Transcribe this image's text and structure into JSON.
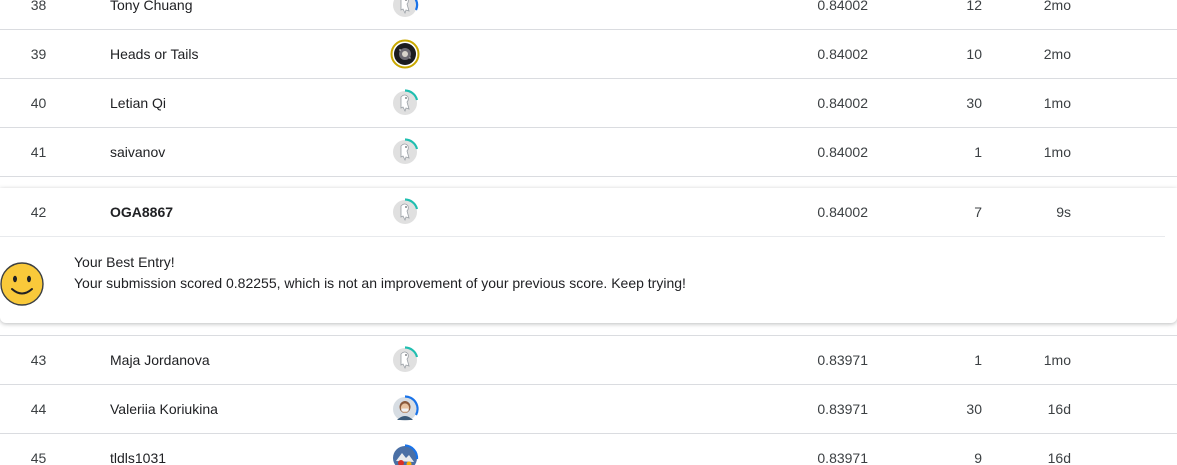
{
  "rows_above": [
    {
      "rank": "38",
      "name": "Tony Chuang",
      "score": "0.84002",
      "entries": "12",
      "last": "2mo",
      "avatar": "default-penguin",
      "ring_color": "#1a73e8"
    },
    {
      "rank": "39",
      "name": "Heads or Tails",
      "score": "0.84002",
      "entries": "10",
      "last": "2mo",
      "avatar": "galaxy-photo",
      "ring_color": "#c9a800"
    },
    {
      "rank": "40",
      "name": "Letian Qi",
      "score": "0.84002",
      "entries": "30",
      "last": "1mo",
      "avatar": "default-penguin",
      "ring_color": "#20beb0"
    },
    {
      "rank": "41",
      "name": "saivanov",
      "score": "0.84002",
      "entries": "1",
      "last": "1mo",
      "avatar": "default-penguin",
      "ring_color": "#20beb0"
    }
  ],
  "own_entry": {
    "rank": "42",
    "name": "OGA8867",
    "score": "0.84002",
    "entries": "7",
    "last": "9s",
    "avatar": "default-penguin",
    "ring_color": "#20beb0",
    "best_title": "Your Best Entry!",
    "best_message": "Your submission scored 0.82255, which is not an improvement of your previous score. Keep trying!",
    "smiley_icon": "smiley-face-icon",
    "smiley_color": "#f9c93a"
  },
  "rows_below": [
    {
      "rank": "43",
      "name": "Maja Jordanova",
      "score": "0.83971",
      "entries": "1",
      "last": "1mo",
      "avatar": "default-penguin",
      "ring_color": "#20beb0"
    },
    {
      "rank": "44",
      "name": "Valeriia Koriukina",
      "score": "0.83971",
      "entries": "30",
      "last": "16d",
      "avatar": "person-photo",
      "ring_color": "#1a73e8"
    },
    {
      "rank": "45",
      "name": "tldls1031",
      "score": "0.83971",
      "entries": "9",
      "last": "16d",
      "avatar": "colorful-photo",
      "ring_color": "#1a73e8"
    }
  ]
}
